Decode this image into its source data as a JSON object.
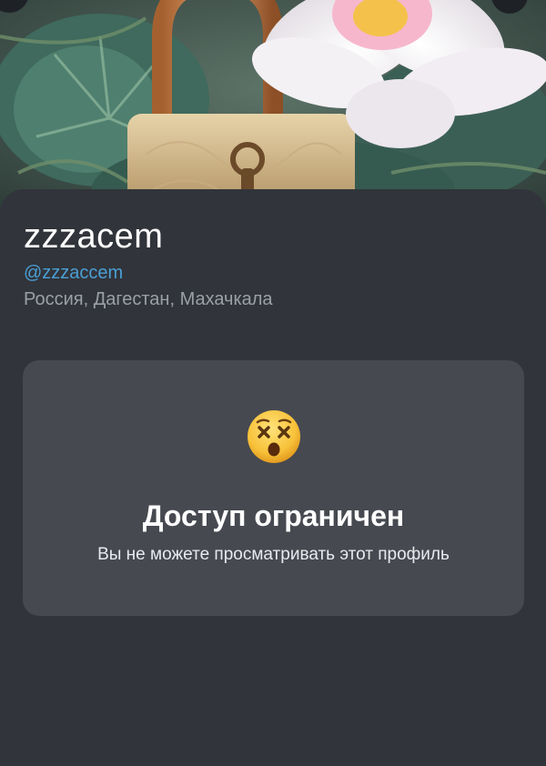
{
  "profile": {
    "name": "zzzacem",
    "handle": "@zzzaccem",
    "location": "Россия, Дагестан, Махачкала"
  },
  "restricted": {
    "emoji_icon": "dizzy-face-icon",
    "title": "Доступ ограничен",
    "subtitle": "Вы не можете просматривать этот профиль"
  },
  "colors": {
    "background": "#31343a",
    "card": "#464950",
    "handle": "#4a9fd6",
    "secondary_text": "#9aa0a8"
  }
}
